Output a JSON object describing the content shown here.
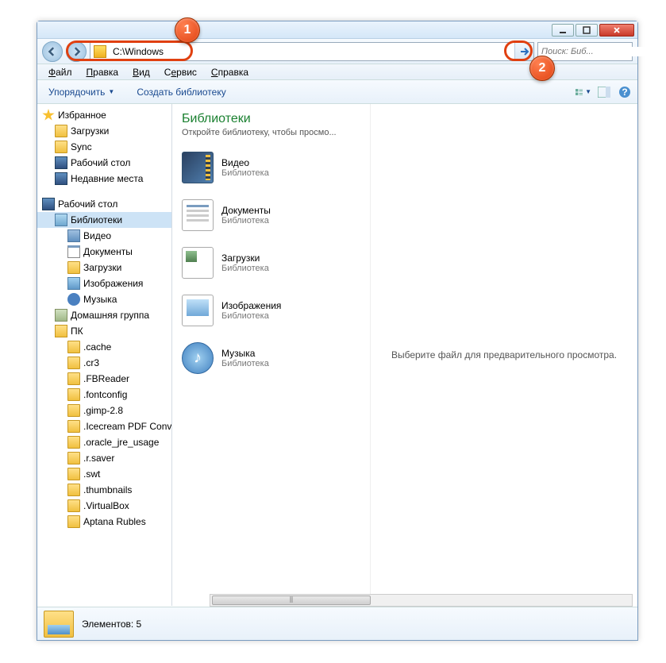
{
  "address": {
    "path": "C:\\Windows"
  },
  "search": {
    "placeholder": "Поиск: Биб..."
  },
  "menu": {
    "file": "Файл",
    "edit": "Правка",
    "view": "Вид",
    "tools": "Сервис",
    "help": "Справка"
  },
  "toolbar": {
    "organize": "Упорядочить",
    "create_lib": "Создать библиотеку"
  },
  "sidebar": {
    "favorites": {
      "label": "Избранное",
      "items": [
        {
          "label": "Загрузки"
        },
        {
          "label": "Sync"
        },
        {
          "label": "Рабочий стол"
        },
        {
          "label": "Недавние места"
        }
      ]
    },
    "desktop": {
      "label": "Рабочий стол"
    },
    "libraries": {
      "label": "Библиотеки",
      "items": [
        {
          "label": "Видео"
        },
        {
          "label": "Документы"
        },
        {
          "label": "Загрузки"
        },
        {
          "label": "Изображения"
        },
        {
          "label": "Музыка"
        }
      ]
    },
    "homegroup": {
      "label": "Домашняя группа"
    },
    "pc": {
      "label": "ПК",
      "items": [
        {
          "label": ".cache"
        },
        {
          "label": ".cr3"
        },
        {
          "label": ".FBReader"
        },
        {
          "label": ".fontconfig"
        },
        {
          "label": ".gimp-2.8"
        },
        {
          "label": ".Icecream PDF Conv"
        },
        {
          "label": ".oracle_jre_usage"
        },
        {
          "label": ".r.saver"
        },
        {
          "label": ".swt"
        },
        {
          "label": ".thumbnails"
        },
        {
          "label": ".VirtualBox"
        },
        {
          "label": "Aptana Rubles"
        }
      ]
    }
  },
  "main": {
    "title": "Библиотеки",
    "subtitle": "Откройте библиотеку, чтобы просмо...",
    "type_label": "Библиотека",
    "items": [
      {
        "name": "Видео"
      },
      {
        "name": "Документы"
      },
      {
        "name": "Загрузки"
      },
      {
        "name": "Изображения"
      },
      {
        "name": "Музыка"
      }
    ]
  },
  "preview": {
    "empty": "Выберите файл для предварительного просмотра."
  },
  "status": {
    "text": "Элементов: 5"
  },
  "callouts": {
    "c1": "1",
    "c2": "2"
  }
}
